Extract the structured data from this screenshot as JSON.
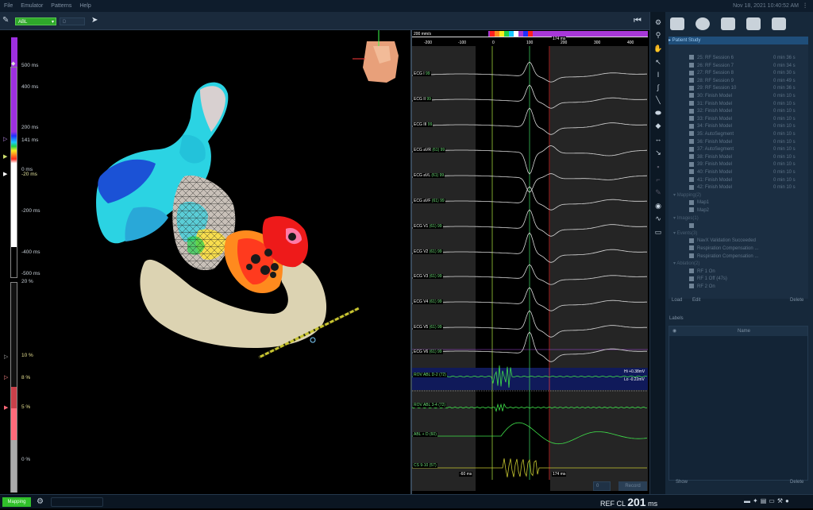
{
  "menu": {
    "items": [
      "File",
      "Emulator",
      "Patterns",
      "Help"
    ],
    "datetime": "Nov 18, 2021 10:40:52 AM"
  },
  "toolbar": {
    "catheter": "ABL",
    "secondary": "D"
  },
  "scale": {
    "labels": [
      "500 ms",
      "400 ms",
      "200 ms",
      "141 ms",
      "0 ms",
      "-20 ms",
      "-200 ms",
      "-400 ms",
      "-500 ms",
      "20 %"
    ],
    "voltage": [
      "10 %",
      "8 %",
      "5 %",
      "0 %"
    ],
    "colors": [
      "#9d2fe0",
      "#2030ff",
      "#19c7ff",
      "#21d04a",
      "#f7ee1f",
      "#ff8a1e",
      "#ff2a1e",
      "#ffffff"
    ]
  },
  "ecg": {
    "speed": "200 mm/s",
    "ticks": [
      "-200",
      "-100",
      "0",
      "100",
      "200",
      "300",
      "400"
    ],
    "window_start": "-60 ms",
    "window_end": "174 ms",
    "window_end_top": "174 ms",
    "channels": [
      {
        "name": "ECG I",
        "gain": "99"
      },
      {
        "name": "ECG II",
        "gain": "99"
      },
      {
        "name": "ECG III",
        "gain": "99"
      },
      {
        "name": "ECG aVR",
        "gain": "(61)  99"
      },
      {
        "name": "ECG aVL",
        "gain": "(61)  99"
      },
      {
        "name": "ECG aVF",
        "gain": "(61)  99"
      },
      {
        "name": "ECG V1",
        "gain": "(61)  99"
      },
      {
        "name": "ECG V2",
        "gain": "(61)  99"
      },
      {
        "name": "ECG V3",
        "gain": "(61)  99"
      },
      {
        "name": "ECG V4",
        "gain": "(61)  99"
      },
      {
        "name": "ECG V5",
        "gain": "(61)  99"
      },
      {
        "name": "ECG V6",
        "gain": "(61)  99"
      },
      {
        "name": "ROV ABL  D-2",
        "gain": "(72)"
      },
      {
        "name": "ROV ABL  3-4",
        "gain": "(72)"
      },
      {
        "name": "ABL + D",
        "gain": "(60)"
      },
      {
        "name": "CS  9-10",
        "gain": "(57)"
      }
    ],
    "hi": "Hi +0.38mV",
    "lo": "Lo -0.22mV",
    "bottom_select": "0",
    "bottom_btn": "Record"
  },
  "tree": {
    "header": "Patient Study",
    "sessions": [
      {
        "name": "25: RF Session 6",
        "time": "0 min 36 s"
      },
      {
        "name": "26: RF Session 7",
        "time": "0 min 34 s"
      },
      {
        "name": "27: RF Session 8",
        "time": "0 min 30 s"
      },
      {
        "name": "28: RF Session 9",
        "time": "0 min 49 s"
      },
      {
        "name": "29: RF Session 10",
        "time": "0 min 36 s"
      },
      {
        "name": "30: Finish Model",
        "time": "0 min 10 s"
      },
      {
        "name": "31: Finish Model",
        "time": "0 min 10 s"
      },
      {
        "name": "32: Finish Model",
        "time": "0 min 10 s"
      },
      {
        "name": "33: Finish Model",
        "time": "0 min 10 s"
      },
      {
        "name": "34: Finish Model",
        "time": "0 min 10 s"
      },
      {
        "name": "35: AutoSegment",
        "time": "0 min 10 s"
      },
      {
        "name": "36: Finish Model",
        "time": "0 min 10 s"
      },
      {
        "name": "37: AutoSegment",
        "time": "0 min 10 s"
      },
      {
        "name": "38: Finish Model",
        "time": "0 min 10 s"
      },
      {
        "name": "39: Finish Model",
        "time": "0 min 10 s"
      },
      {
        "name": "40: Finish Model",
        "time": "0 min 10 s"
      },
      {
        "name": "41: Finish Model",
        "time": "0 min 10 s"
      },
      {
        "name": "42: Finish Model",
        "time": "0 min 10 s"
      }
    ],
    "groups": [
      {
        "name": "Mapping(2)",
        "items": [
          "Map1",
          "Map2"
        ]
      },
      {
        "name": "Images(1)",
        "items": [
          ""
        ]
      },
      {
        "name": "Events(3)",
        "items": [
          "NavX Validation Succeeded",
          "Respiration Compensation ...",
          "Respiration Compensation ..."
        ]
      },
      {
        "name": "Ablation(2)",
        "items": [
          "RF 1 On",
          "RF 1 Off (47s)",
          "RF 2 On"
        ]
      }
    ],
    "load": "Load",
    "edit": "Edit",
    "delete": "Delete"
  },
  "labels": {
    "title": "Labels",
    "col": "Name",
    "show": "Show",
    "delete": "Delete"
  },
  "status": {
    "mode": "Mapping",
    "ref": "REF",
    "cl": "CL",
    "cl_value": "201",
    "unit": "ms"
  }
}
